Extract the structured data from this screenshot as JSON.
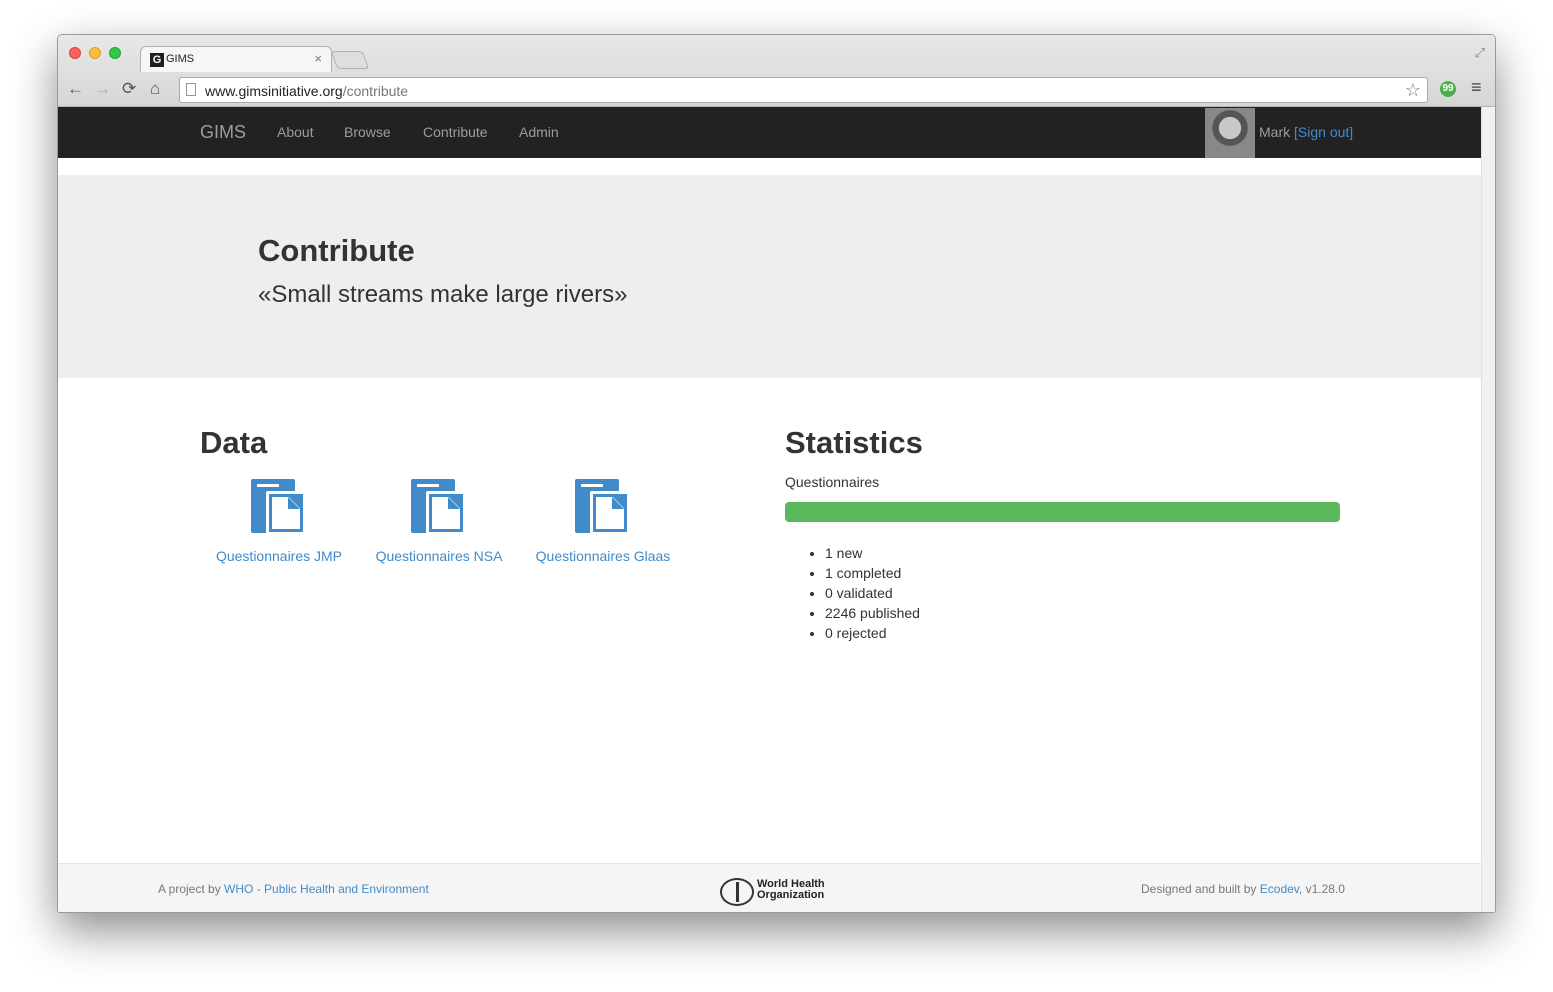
{
  "browser": {
    "tab_title": "GIMS",
    "tab_favicon_letter": "G",
    "tab_close": "×",
    "url_host": "www.gimsinitiative.org",
    "url_path": "/contribute",
    "back_icon": "←",
    "forward_icon": "→",
    "reload_icon": "⟳",
    "home_icon": "⌂",
    "star_icon": "☆",
    "menu_icon": "≡",
    "fullscreen_icon": "⤢",
    "extension_icon": "99"
  },
  "navbar": {
    "brand": "GIMS",
    "links": [
      "About",
      "Browse",
      "Contribute",
      "Admin"
    ],
    "user_name": "Mark",
    "sign_out": "[Sign out]"
  },
  "jumbotron": {
    "title": "Contribute",
    "subtitle": "«Small streams make large rivers»"
  },
  "data_section": {
    "heading": "Data",
    "links": [
      "Questionnaires JMP",
      "Questionnaires NSA",
      "Questionnaires Glaas"
    ]
  },
  "statistics": {
    "heading": "Statistics",
    "label": "Questionnaires",
    "progress_percent": 100,
    "progress_color": "#5cb85c",
    "items": [
      "1 new",
      "1 completed",
      "0 validated",
      "2246 published",
      "0 rejected"
    ]
  },
  "footer": {
    "left_prefix": "A project by",
    "left_link": "WHO - Public Health and Environment",
    "logo_text_line1": "World Health",
    "logo_text_line2": "Organization",
    "right_prefix": "Designed and built by",
    "right_link": "Ecodev",
    "version": ", v1.28.0"
  },
  "colors": {
    "navbar_bg": "#222222",
    "link": "#428bca",
    "jumbotron_bg": "#eeeeee"
  }
}
